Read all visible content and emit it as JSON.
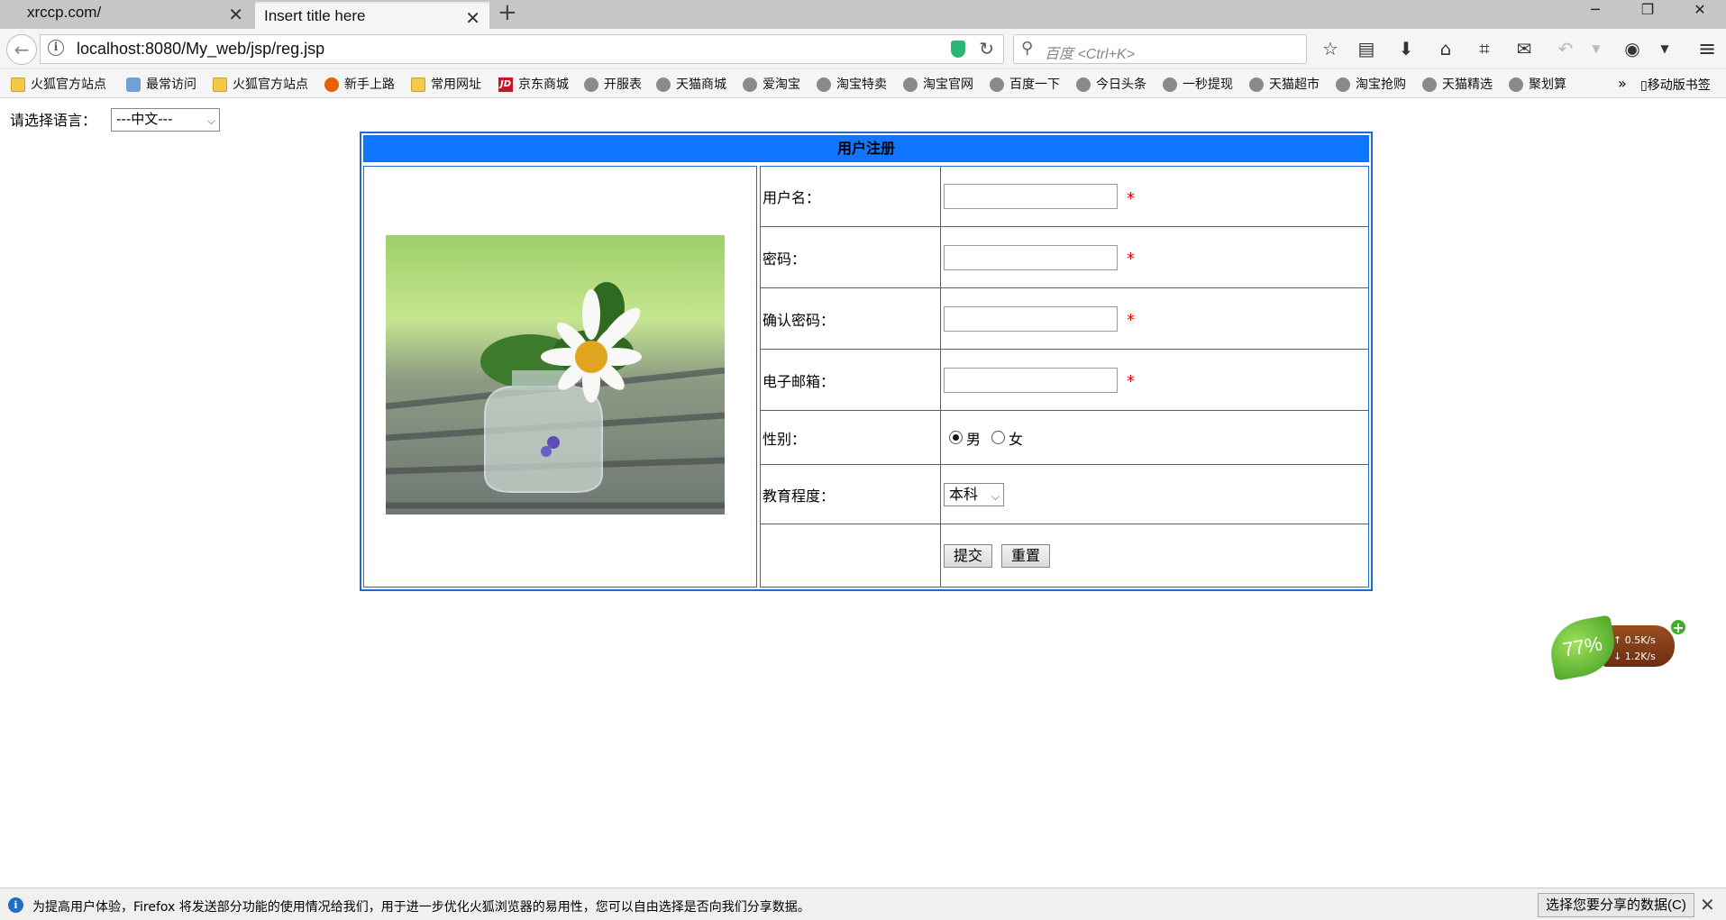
{
  "browser": {
    "tabs": [
      {
        "title": "xrccp.com/",
        "active": false
      },
      {
        "title": "Insert title here",
        "active": true
      }
    ],
    "url": "localhost:8080/My_web/jsp/reg.jsp",
    "search_placeholder": "百度 <Ctrl+K>",
    "bookmarks": [
      {
        "label": "火狐官方站点",
        "icon": "folder-icon"
      },
      {
        "label": "最常访问",
        "icon": "most-visited-icon"
      },
      {
        "label": "火狐官方站点",
        "icon": "folder-icon"
      },
      {
        "label": "新手上路",
        "icon": "firefox-icon"
      },
      {
        "label": "常用网址",
        "icon": "folder-icon"
      },
      {
        "label": "京东商城",
        "icon": "jd-icon"
      },
      {
        "label": "开服表",
        "icon": "globe-icon"
      },
      {
        "label": "天猫商城",
        "icon": "globe-icon"
      },
      {
        "label": "爱淘宝",
        "icon": "globe-icon"
      },
      {
        "label": "淘宝特卖",
        "icon": "globe-icon"
      },
      {
        "label": "淘宝官网",
        "icon": "globe-icon"
      },
      {
        "label": "百度一下",
        "icon": "globe-icon"
      },
      {
        "label": "今日头条",
        "icon": "globe-icon"
      },
      {
        "label": "一秒提现",
        "icon": "globe-icon"
      },
      {
        "label": "天猫超市",
        "icon": "globe-icon"
      },
      {
        "label": "淘宝抢购",
        "icon": "globe-icon"
      },
      {
        "label": "天猫精选",
        "icon": "globe-icon"
      },
      {
        "label": "聚划算",
        "icon": "globe-icon"
      }
    ],
    "more_bookmarks": "»",
    "mobile_bookmarks": "移动版书签"
  },
  "page": {
    "language_label": "请选择语言：",
    "language_selected": "---中文---",
    "form_title": "用户注册",
    "fields": [
      {
        "label": "用户名：",
        "value": "",
        "required": "*"
      },
      {
        "label": "密码：",
        "value": "",
        "required": "*"
      },
      {
        "label": "确认密码：",
        "value": "",
        "required": "*"
      },
      {
        "label": "电子邮箱：",
        "value": "",
        "required": "*"
      }
    ],
    "gender": {
      "label": "性别：",
      "options": [
        "男",
        "女"
      ],
      "selected": "男"
    },
    "education": {
      "label": "教育程度：",
      "selected": "本科"
    },
    "submit_label": "提交",
    "reset_label": "重置"
  },
  "widget": {
    "percent": "77%",
    "upload": "0.5K/s",
    "download": "1.2K/s"
  },
  "notification": {
    "text": "为提高用户体验，Firefox 将发送部分功能的使用情况给我们，用于进一步优化火狐浏览器的易用性，您可以自由选择是否向我们分享数据。",
    "button": "选择您要分享的数据(C)"
  }
}
